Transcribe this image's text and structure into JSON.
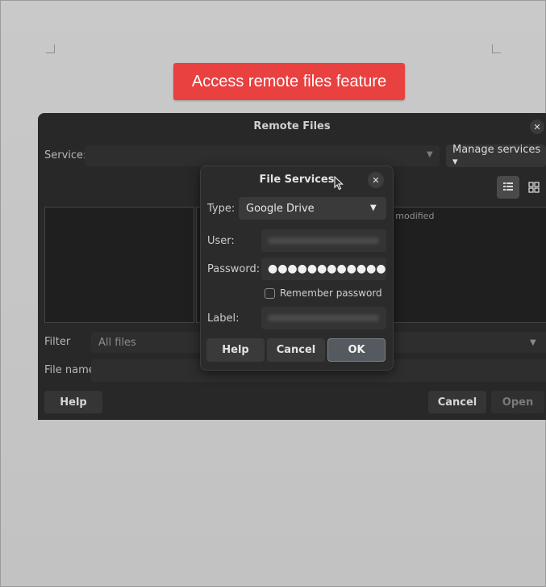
{
  "banner": {
    "text": "Access remote files feature",
    "color": "#e94040"
  },
  "remote_files": {
    "title": "Remote Files",
    "service_label": "Service:",
    "service_value": "",
    "manage_services": "Manage services ▾",
    "column_partial": "e modified",
    "filter_label": "Filter",
    "filter_value": "All files",
    "file_name_label": "File name",
    "file_name_value": "",
    "help": "Help",
    "cancel": "Cancel",
    "open": "Open"
  },
  "file_services": {
    "title": "File Services",
    "type_label": "Type:",
    "type_value": "Google Drive",
    "user_label": "User:",
    "password_label": "Password:",
    "password_mask": "●●●●●●●●●●●●",
    "remember_password": "Remember password",
    "remember_checked": false,
    "label_label": "Label:",
    "help": "Help",
    "cancel": "Cancel",
    "ok": "OK"
  }
}
